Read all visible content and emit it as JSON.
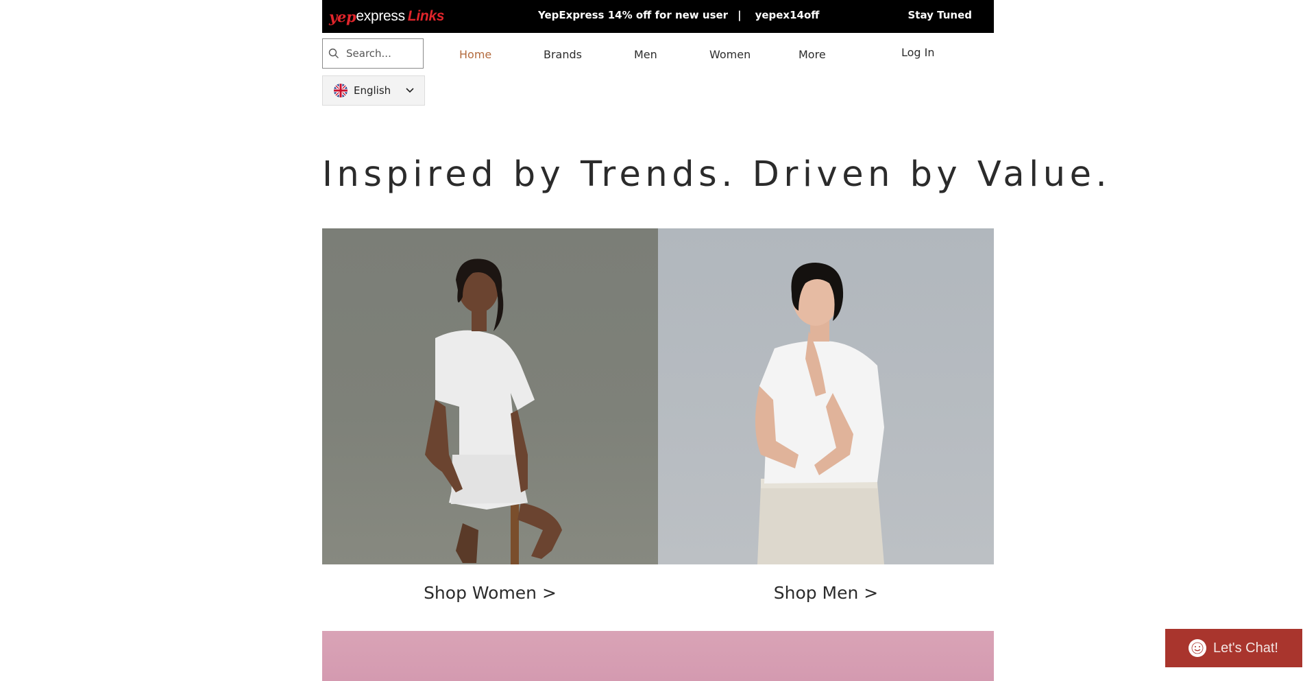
{
  "topbar": {
    "logo": {
      "yep": "yep",
      "express": "express",
      "links": "Links"
    },
    "promo_text": "YepExpress 14% off for new user",
    "promo_separator": "|",
    "promo_code": "yepex14off",
    "stay_tuned": "Stay Tuned"
  },
  "search": {
    "placeholder": "Search...",
    "icon": "search-icon"
  },
  "language": {
    "selected": "English",
    "flag": "uk-flag-icon"
  },
  "nav": {
    "items": [
      {
        "label": "Home",
        "active": true
      },
      {
        "label": "Brands",
        "active": false
      },
      {
        "label": "Men",
        "active": false
      },
      {
        "label": "Women",
        "active": false
      },
      {
        "label": "More",
        "active": false
      }
    ],
    "login": "Log In"
  },
  "hero": {
    "heading": "Inspired by Trends. Driven by Value."
  },
  "shop": {
    "women": "Shop Women >",
    "men": "Shop Men >"
  },
  "chat": {
    "label": "Let's Chat!"
  },
  "colors": {
    "topbar_bg": "#000000",
    "brand_red": "#e0252b",
    "active_nav": "#b36a3d",
    "chat_bg": "#a9352d",
    "pink_banner": "#d9a3b6"
  }
}
